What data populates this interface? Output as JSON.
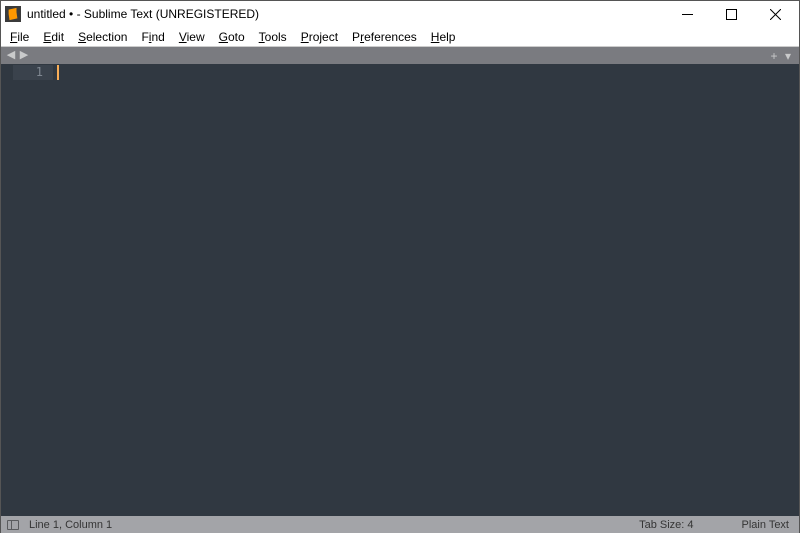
{
  "titlebar": {
    "title": "untitled • - Sublime Text (UNREGISTERED)"
  },
  "menus": {
    "file": "File",
    "edit": "Edit",
    "selection": "Selection",
    "find": "Find",
    "view": "View",
    "goto": "Goto",
    "tools": "Tools",
    "project": "Project",
    "preferences": "Preferences",
    "help": "Help"
  },
  "editor": {
    "line_numbers": [
      "1"
    ]
  },
  "statusbar": {
    "position": "Line 1, Column 1",
    "tab_size": "Tab Size: 4",
    "syntax": "Plain Text"
  }
}
